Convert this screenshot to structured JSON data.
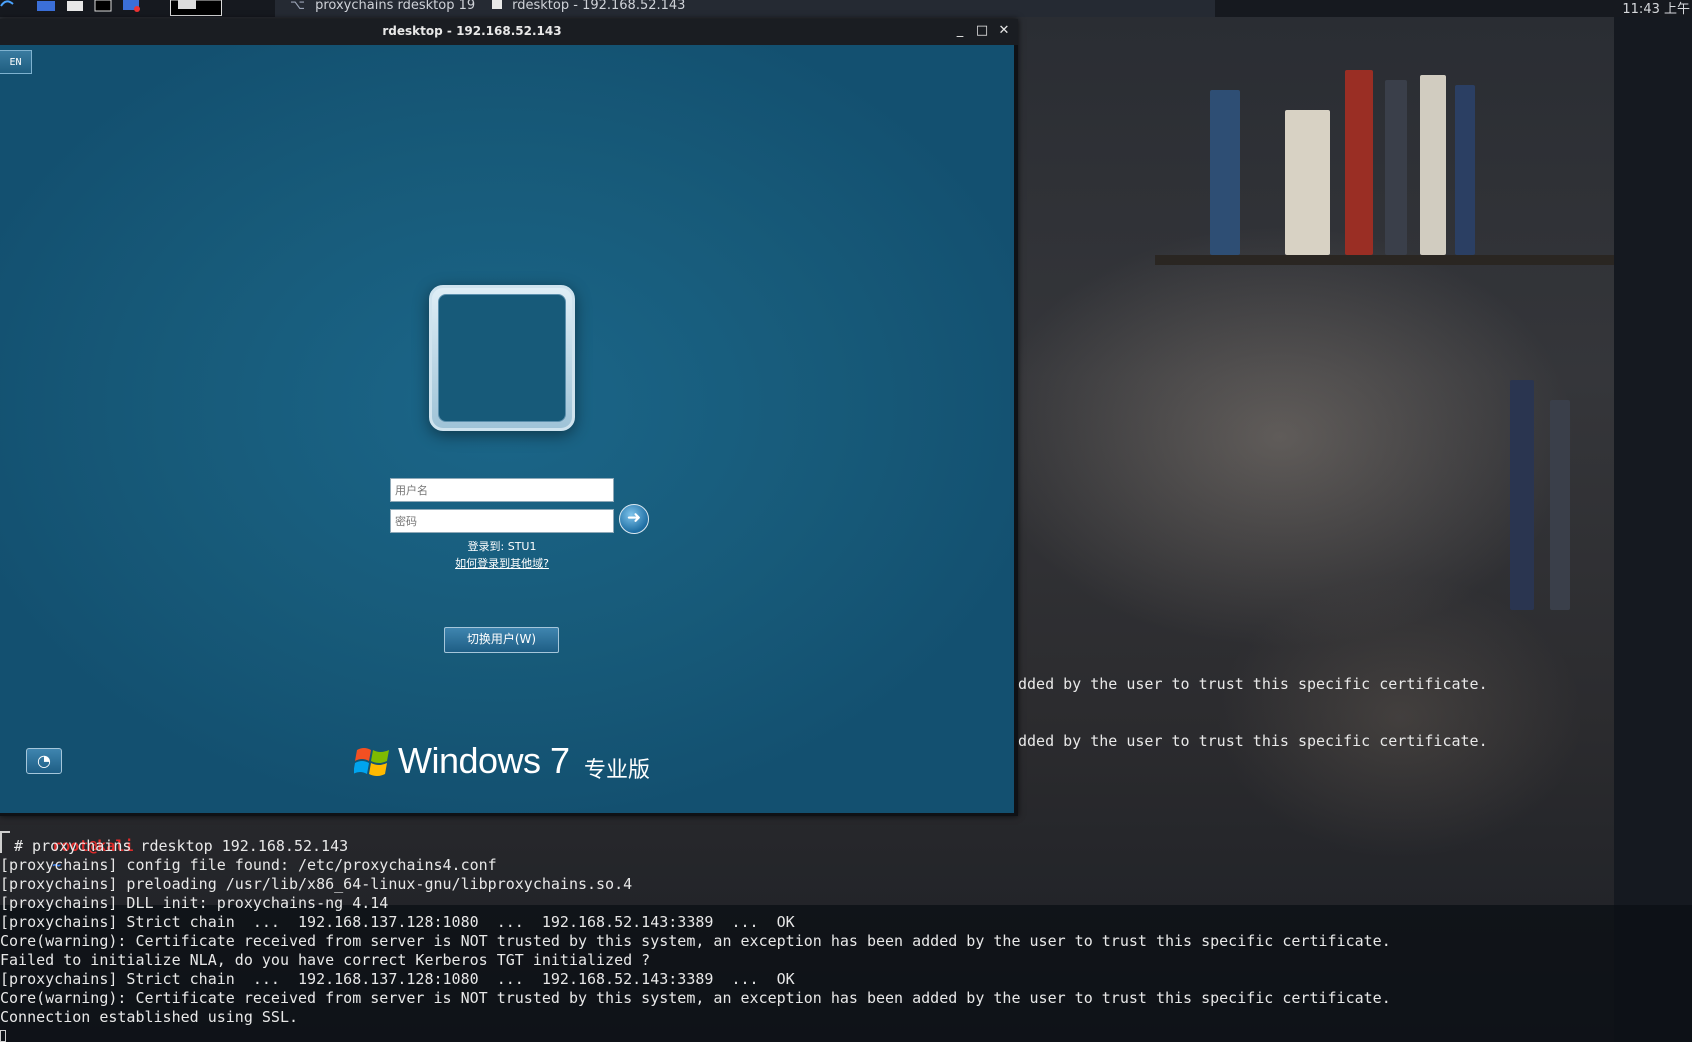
{
  "top_panel": {
    "tasks": [
      {
        "label": "proxychains rdesktop 19...",
        "icon": "terminal-icon"
      },
      {
        "label": "rdesktop - 192.168.52.143",
        "icon": "window-icon"
      }
    ],
    "clock": "11:43 上午"
  },
  "rdesktop_window": {
    "title": "rdesktop - 192.168.52.143",
    "minimize": "_",
    "maximize": "□",
    "close": "✕"
  },
  "logon_screen": {
    "language": "EN",
    "username_placeholder": "用户名",
    "password_placeholder": "密码",
    "logon_to": "登录到: STU1",
    "other_domain_link": "如何登录到其他域?",
    "switch_user": "切换用户(W)",
    "brand": "Windows 7",
    "edition": "专业版"
  },
  "terminal": {
    "background_lines": [
      "dded by the user to trust this specific certificate.",
      "dded by the user to trust this specific certificate."
    ],
    "prompt_user": "root@kali",
    "prompt_path": "~",
    "command": "# proxychains rdesktop 192.168.52.143",
    "output": [
      "[proxychains] config file found: /etc/proxychains4.conf",
      "[proxychains] preloading /usr/lib/x86_64-linux-gnu/libproxychains.so.4",
      "[proxychains] DLL init: proxychains-ng 4.14",
      "[proxychains] Strict chain  ...  192.168.137.128:1080  ...  192.168.52.143:3389  ...  OK",
      "Core(warning): Certificate received from server is NOT trusted by this system, an exception has been added by the user to trust this specific certificate.",
      "Failed to initialize NLA, do you have correct Kerberos TGT initialized ?",
      "[proxychains] Strict chain  ...  192.168.137.128:1080  ...  192.168.52.143:3389  ...  OK",
      "Core(warning): Certificate received from server is NOT trusted by this system, an exception has been added by the user to trust this specific certificate.",
      "Connection established using SSL."
    ]
  },
  "colors": {
    "logon_bg": "#175a79",
    "prompt_user": "#e02b2b",
    "prompt_path": "#3c7ee8"
  }
}
